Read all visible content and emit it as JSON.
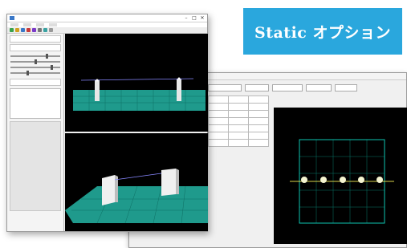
{
  "badge": {
    "text": "Static オプション"
  },
  "front_window": {
    "menu": [
      "",
      "",
      "",
      "",
      ""
    ]
  },
  "colors": {
    "badge_bg": "#2aa7dd",
    "grid_cyan": "#0fd8c4",
    "ground": "#1f9a8c"
  }
}
